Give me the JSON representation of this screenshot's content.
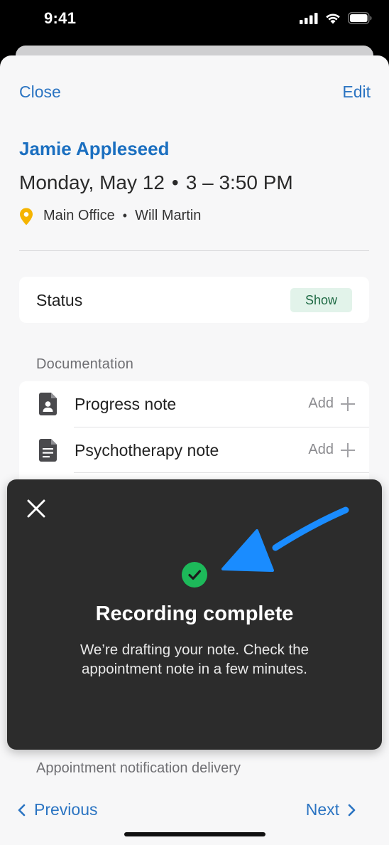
{
  "status_bar": {
    "time": "9:41"
  },
  "header": {
    "close_label": "Close",
    "edit_label": "Edit"
  },
  "appointment": {
    "client_name": "Jamie Appleseed",
    "date": "Monday, May 12",
    "time_range": "3 – 3:50 PM",
    "location": "Main Office",
    "clinician": "Will Martin"
  },
  "status": {
    "label": "Status",
    "badge": "Show"
  },
  "documentation": {
    "header": "Documentation",
    "items": [
      {
        "label": "Progress note",
        "action": "Add",
        "icon": "person-document-icon"
      },
      {
        "label": "Psychotherapy note",
        "action": "Add",
        "icon": "document-icon"
      }
    ]
  },
  "toast": {
    "title": "Recording complete",
    "body": "We’re drafting your note. Check the appointment note in a few minutes.",
    "success_color": "#1db95a"
  },
  "notification_section": {
    "header": "Appointment notification delivery"
  },
  "footer": {
    "previous_label": "Previous",
    "next_label": "Next"
  },
  "colors": {
    "accent": "#2b74c2",
    "arrow": "#1a8cff",
    "toast_bg": "#2c2c2c"
  }
}
